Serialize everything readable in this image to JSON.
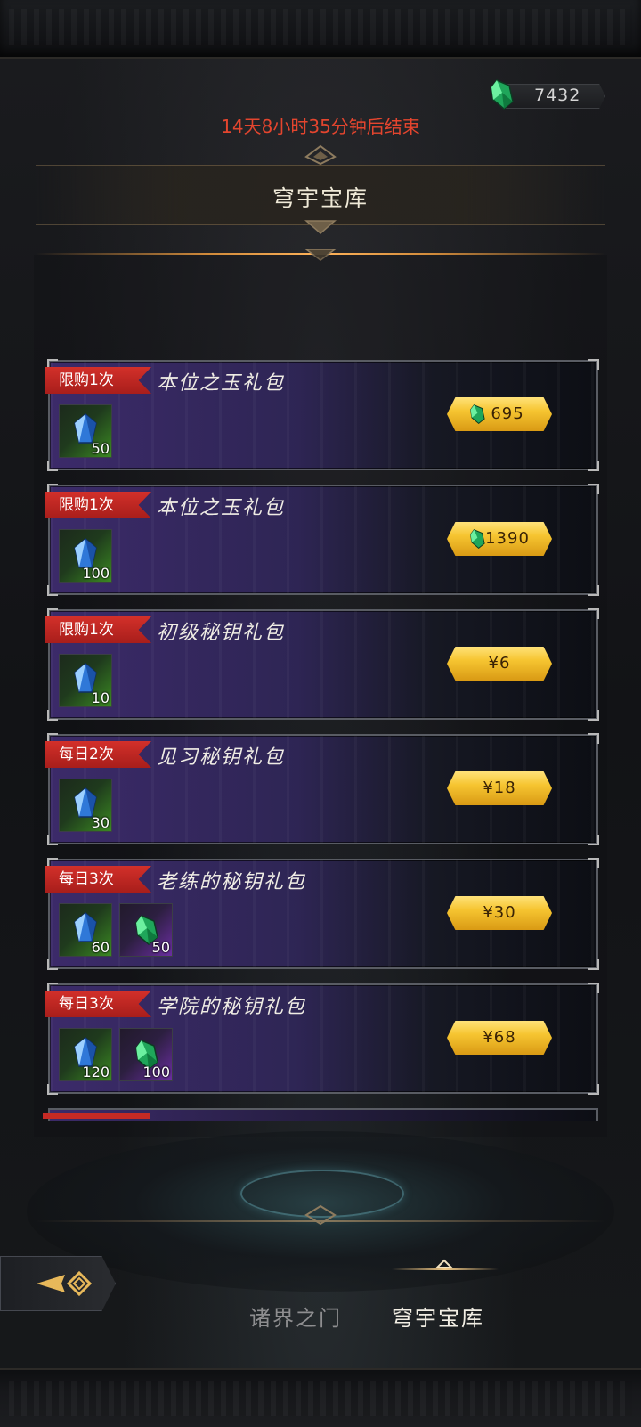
{
  "currency": {
    "value": "7432",
    "icon": "green-gem-icon"
  },
  "countdown": "14天8小时35分钟后结束",
  "page_title": "穹宇宝库",
  "packs": [
    {
      "tag": "限购1次",
      "title": "本位之玉礼包",
      "items": [
        {
          "icon": "blue-crystal-icon",
          "count": "50",
          "rarity": "green"
        }
      ],
      "price": "695",
      "price_currency": "gem"
    },
    {
      "tag": "限购1次",
      "title": "本位之玉礼包",
      "items": [
        {
          "icon": "blue-crystal-icon",
          "count": "100",
          "rarity": "green"
        }
      ],
      "price": "1390",
      "price_currency": "gem"
    },
    {
      "tag": "限购1次",
      "title": "初级秘钥礼包",
      "items": [
        {
          "icon": "blue-crystal-icon",
          "count": "10",
          "rarity": "green"
        }
      ],
      "price": "¥6",
      "price_currency": "cny"
    },
    {
      "tag": "每日2次",
      "title": "见习秘钥礼包",
      "items": [
        {
          "icon": "blue-crystal-icon",
          "count": "30",
          "rarity": "green"
        }
      ],
      "price": "¥18",
      "price_currency": "cny"
    },
    {
      "tag": "每日3次",
      "title": "老练的秘钥礼包",
      "items": [
        {
          "icon": "blue-crystal-icon",
          "count": "60",
          "rarity": "green"
        },
        {
          "icon": "green-gem-icon",
          "count": "50",
          "rarity": "purple"
        }
      ],
      "price": "¥30",
      "price_currency": "cny"
    },
    {
      "tag": "每日3次",
      "title": "学院的秘钥礼包",
      "items": [
        {
          "icon": "blue-crystal-icon",
          "count": "120",
          "rarity": "green"
        },
        {
          "icon": "green-gem-icon",
          "count": "100",
          "rarity": "purple"
        }
      ],
      "price": "¥68",
      "price_currency": "cny"
    }
  ],
  "nav": {
    "back_icon": "back-arrow-icon",
    "tabs": [
      {
        "label": "诸界之门",
        "active": false
      },
      {
        "label": "穹宇宝库",
        "active": true
      }
    ]
  },
  "colors": {
    "countdown": "#e4452e",
    "price_button": "#f6c531",
    "tag": "#c52a24"
  }
}
